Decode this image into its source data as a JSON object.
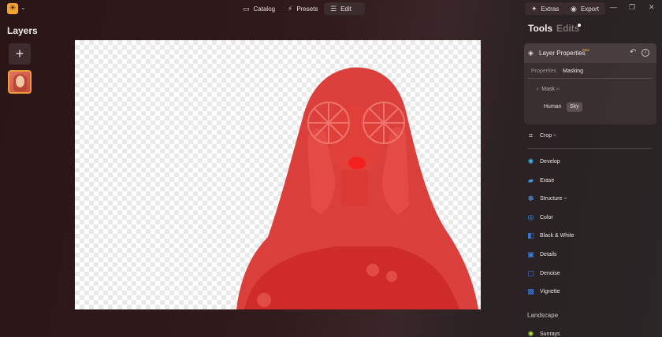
{
  "topbar": {
    "nav": [
      {
        "label": "Catalog",
        "icon": "folder-icon"
      },
      {
        "label": "Presets",
        "icon": "wand-icon"
      },
      {
        "label": "Edit",
        "icon": "sliders-icon"
      }
    ],
    "extras_label": "Extras",
    "export_label": "Export"
  },
  "layers": {
    "title": "Layers"
  },
  "panel": {
    "tab_tools": "Tools",
    "tab_edits": "Edits",
    "layer_properties": {
      "title": "Layer Properties",
      "badge": "PRO",
      "tabs": [
        "Properties",
        "Masking"
      ],
      "mask_label": "Mask",
      "mask_badge": "AI",
      "chips": [
        "Human",
        "Sky"
      ]
    },
    "crop": {
      "label": "Crop",
      "badge": "AI"
    },
    "tools": [
      {
        "label": "Develop",
        "color": "#3fb7e8"
      },
      {
        "label": "Erase",
        "color": "#3a9ee8"
      },
      {
        "label": "Structure",
        "badge": "AI",
        "color": "#3a8fe8"
      },
      {
        "label": "Color",
        "color": "#3a8fe8"
      },
      {
        "label": "Black & White",
        "color": "#3a7fe8"
      },
      {
        "label": "Details",
        "color": "#3a7fe8"
      },
      {
        "label": "Denoise",
        "color": "#3a7fe8"
      },
      {
        "label": "Vignette",
        "color": "#3a7fe8"
      }
    ],
    "section": "Landscape",
    "landscape_tools": [
      {
        "label": "Sunrays",
        "color": "#b0e03a"
      }
    ]
  },
  "colors": {
    "accent": "#f09a3a",
    "mask": "#e0322f"
  }
}
